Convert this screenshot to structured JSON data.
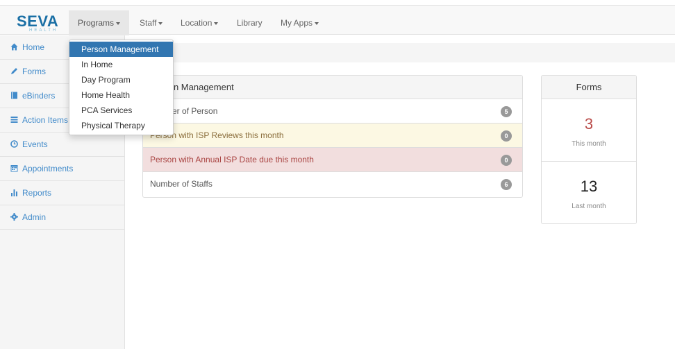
{
  "logo": {
    "main": "SEVA",
    "sub": "HEALTH"
  },
  "nav": {
    "items": [
      {
        "label": "Programs",
        "caret": true,
        "active": true
      },
      {
        "label": "Staff",
        "caret": true
      },
      {
        "label": "Location",
        "caret": true
      },
      {
        "label": "Library",
        "caret": false
      },
      {
        "label": "My Apps",
        "caret": true
      }
    ]
  },
  "sidebar": {
    "items": [
      {
        "label": "Home",
        "icon": "home-icon"
      },
      {
        "label": "Forms",
        "icon": "pencil-icon"
      },
      {
        "label": "eBinders",
        "icon": "book-icon"
      },
      {
        "label": "Action Items",
        "icon": "list-icon"
      },
      {
        "label": "Events",
        "icon": "clock-icon"
      },
      {
        "label": "Appointments",
        "icon": "calendar-icon"
      },
      {
        "label": "Reports",
        "icon": "bar-chart-icon"
      },
      {
        "label": "Admin",
        "icon": "gear-icon"
      }
    ]
  },
  "dropdown": {
    "items": [
      {
        "label": "Person Management",
        "active": true
      },
      {
        "label": "In Home"
      },
      {
        "label": "Day Program"
      },
      {
        "label": "Home Health"
      },
      {
        "label": "PCA Services"
      },
      {
        "label": "Physical Therapy"
      }
    ]
  },
  "panel": {
    "title": "Person Management",
    "rows": [
      {
        "label": "Number of Person",
        "count": "5",
        "style": "plain"
      },
      {
        "label": "Person with ISP Reviews this month",
        "count": "0",
        "style": "warn"
      },
      {
        "label": "Person with Annual ISP Date due this month",
        "count": "0",
        "style": "danger"
      },
      {
        "label": "Number of Staffs",
        "count": "6",
        "style": "plain"
      }
    ]
  },
  "forms": {
    "title": "Forms",
    "this_month": {
      "value": "3",
      "label": "This month"
    },
    "last_month": {
      "value": "13",
      "label": "Last month"
    }
  },
  "colors": {
    "link": "#428bca",
    "active_menu": "#3276b1",
    "this_month_value": "#b94a48"
  }
}
